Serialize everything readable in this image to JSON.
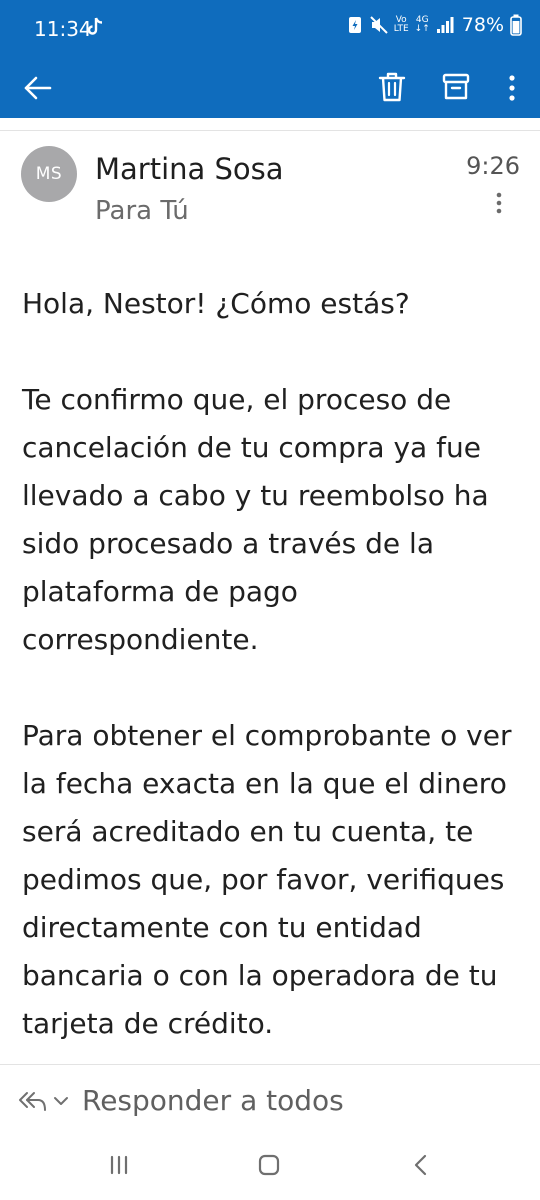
{
  "status_bar": {
    "time": "11:34",
    "battery": "78%",
    "network_top": "Vo",
    "network_bottom": "LTE",
    "signal_top": "4G"
  },
  "toolbar": {
    "back_icon": "arrow-left-icon",
    "delete_icon": "trash-icon",
    "archive_icon": "archive-icon",
    "more_icon": "more-vertical-icon",
    "accent_color": "#0f6cbd"
  },
  "message": {
    "avatar_initials": "MS",
    "avatar_color": "#a8a8aa",
    "sender": "Martina Sosa",
    "recipient": "Para Tú",
    "time": "9:26",
    "paragraphs": [
      "Hola, Nestor! ¿Cómo estás?",
      "Te confirmo que, el proceso de cancelación de tu compra ya fue llevado a cabo y tu reembolso ha sido procesado a través de la plataforma de pago correspondiente.",
      "Para obtener el comprobante o ver la fecha exacta en la que el dinero será acreditado en tu cuenta, te pedimos que, por favor, verifiques directamente con tu entidad bancaria o con la operadora de tu tarjeta de crédito."
    ]
  },
  "reply_bar": {
    "label": "Responder a todos"
  },
  "nav_bar": {
    "recent_icon": "recent-apps-icon",
    "home_icon": "home-icon",
    "back_icon": "nav-back-icon"
  }
}
